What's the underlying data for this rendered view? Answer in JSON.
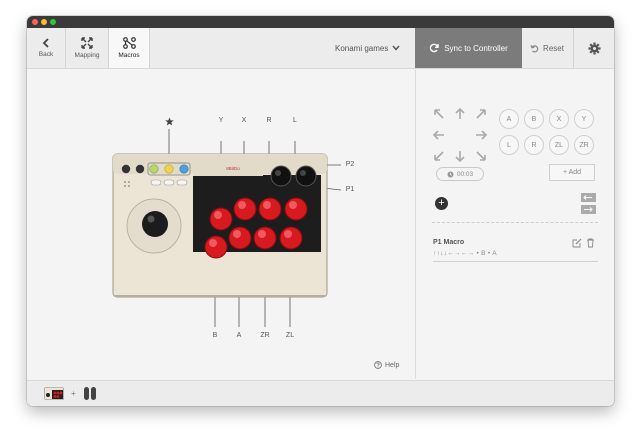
{
  "toolbar": {
    "back_label": "Back",
    "mapping_label": "Mapping",
    "macros_label": "Macros",
    "game_selected": "Konami games",
    "sync_label": "Sync to Controller",
    "reset_label": "Reset"
  },
  "stick": {
    "top_labels": [
      "Y",
      "X",
      "R",
      "L"
    ],
    "bottom_labels": [
      "B",
      "A",
      "ZR",
      "ZL"
    ],
    "side_labels": [
      "P2",
      "P1"
    ],
    "brand_text": "8BitDo"
  },
  "macro_editor": {
    "face_buttons": [
      "A",
      "B",
      "X",
      "Y",
      "L",
      "R",
      "ZL",
      "ZR"
    ],
    "timer": "00:03",
    "add_label": "+ Add"
  },
  "macro_list": [
    {
      "name": "P1 Macro",
      "sequence": "↑↑↓↓←→←→ • B • A"
    }
  ],
  "help_label": "Help",
  "bottom_bar": {
    "plus": "+"
  },
  "colors": {
    "accent_red": "#d71a1f",
    "sync_bg": "#7b7b7b",
    "stick_body": "#ece5d6"
  }
}
